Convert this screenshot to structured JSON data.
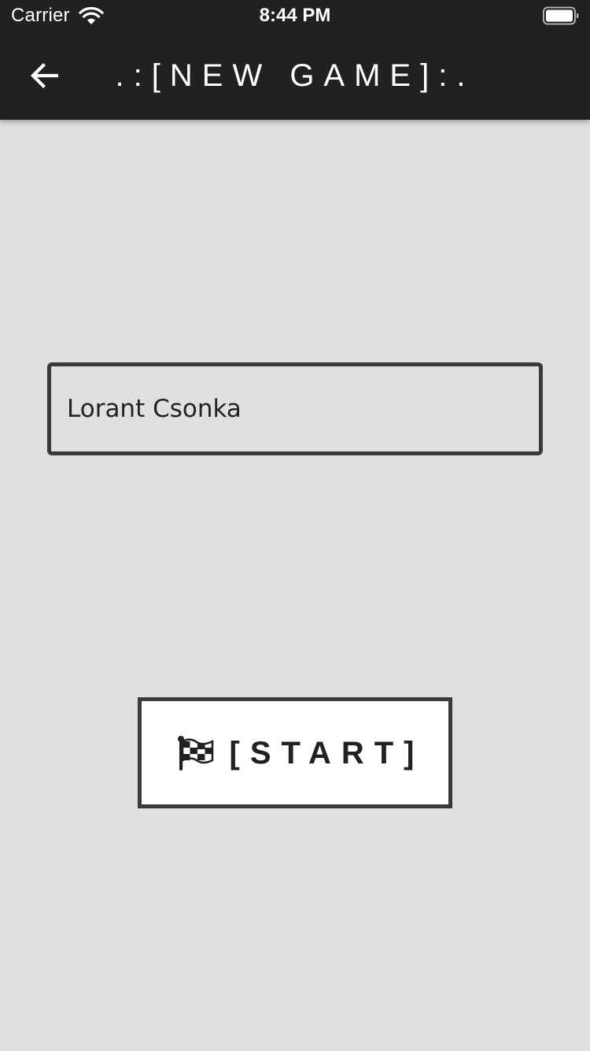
{
  "status_bar": {
    "carrier": "Carrier",
    "time": "8:44 PM",
    "wifi_icon": "wifi-icon",
    "battery_icon": "battery-icon"
  },
  "header": {
    "back_icon": "arrow-left-icon",
    "title": ".:[NEW GAME]:."
  },
  "form": {
    "player_name_value": "Lorant Csonka"
  },
  "start_button": {
    "icon": "checkered-flag-icon",
    "label": "[START]"
  },
  "colors": {
    "appbar": "#212121",
    "background": "#e0e0e0",
    "border": "#3a3a3a",
    "button_bg": "#ffffff",
    "text_dark": "#212121",
    "text_light": "#ffffff"
  }
}
